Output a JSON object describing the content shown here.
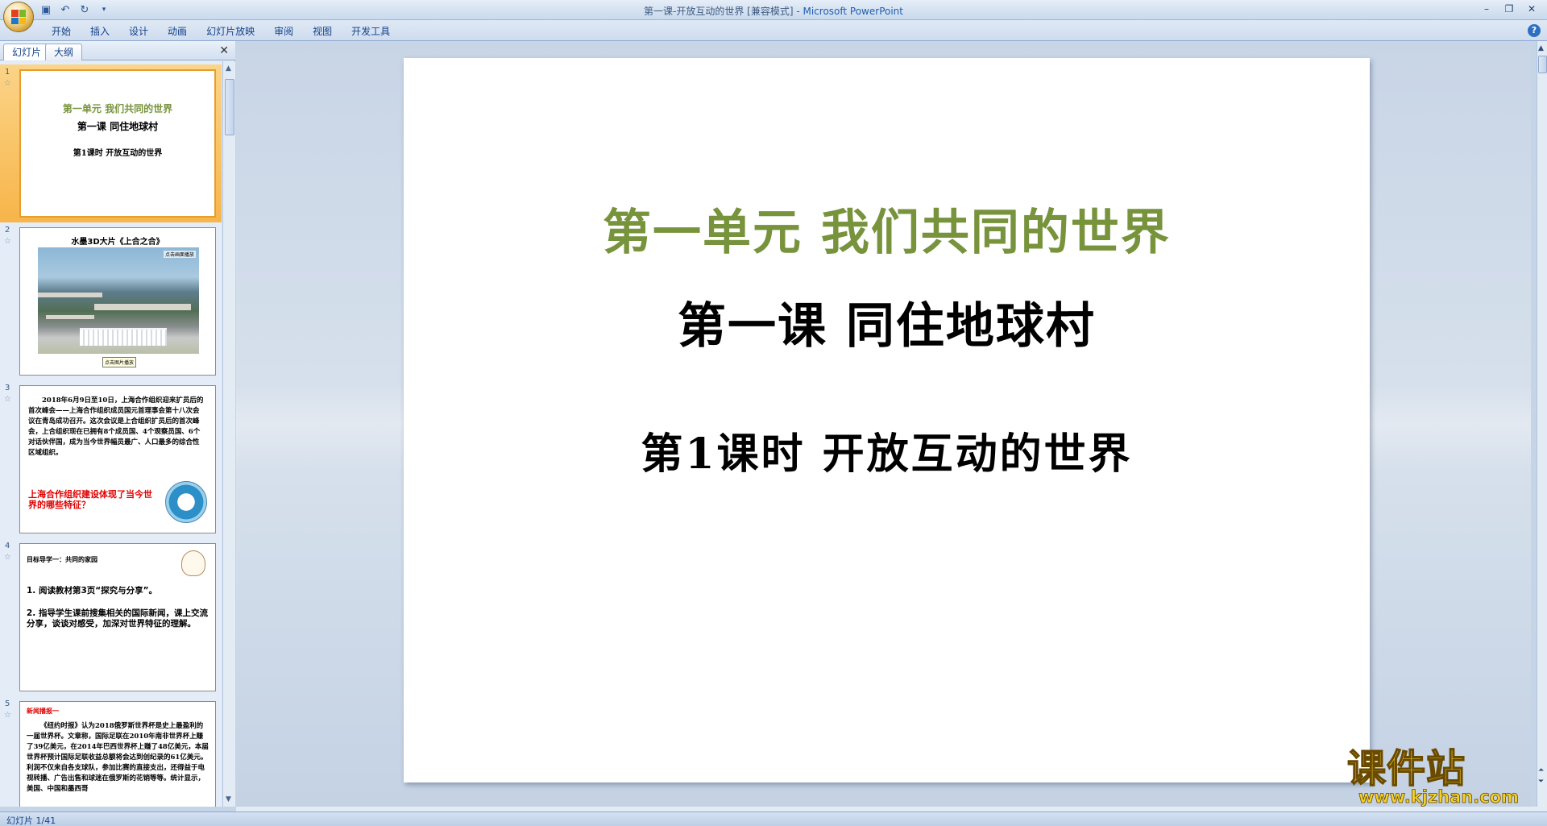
{
  "window": {
    "title": "第一课-开放互动的世界 [兼容模式]",
    "separator": " - ",
    "app_name": "Microsoft PowerPoint",
    "controls": [
      "–",
      "❐",
      "✕"
    ]
  },
  "quick_access": {
    "icons": [
      "save-icon",
      "undo-icon",
      "redo-icon",
      "customize-icon"
    ]
  },
  "ribbon": {
    "tabs": [
      "开始",
      "插入",
      "设计",
      "动画",
      "幻灯片放映",
      "审阅",
      "视图",
      "开发工具"
    ]
  },
  "left_panel": {
    "tabs": [
      "幻灯片",
      "大纲"
    ],
    "close_glyph": "✕"
  },
  "thumbnails": [
    {
      "num": "1",
      "line1": "第一单元  我们共同的世界",
      "line2": "第一课  同住地球村",
      "line3": "第1课时  开放互动的世界"
    },
    {
      "num": "2",
      "title": "水墨3D大片《上合之合》",
      "label1": "点击画面播放",
      "label2": "点击图片播放"
    },
    {
      "num": "3",
      "text": "2018年6月9日至10日，上海合作组织迎来扩员后的首次峰会——上海合作组织成员国元首理事会第十八次会议在青岛成功召开。这次会议是上合组织扩员后的首次峰会，上合组织现在已拥有8个成员国、4个观察员国、6个对话伙伴国，成为当今世界幅员最广、人口最多的综合性区域组织。",
      "question": "上海合作组织建设体现了当今世界的哪些特征？"
    },
    {
      "num": "4",
      "heading": "目标导学一：共同的家园",
      "item1": "1. 阅读教材第3页“探究与分享”。",
      "item2": "2. 指导学生课前搜集相关的国际新闻，课上交流分享，谈谈对感受，加深对世界特征的理解。"
    },
    {
      "num": "5",
      "heading": "新闻播报一",
      "text": "《纽约时报》认为2018俄罗斯世界杯是史上最盈利的一届世界杯。文章称，国际足联在2010年南非世界杯上赚了39亿美元，在2014年巴西世界杯上赚了48亿美元，本届世界杯预计国际足联收益总额将会达到创纪录的61亿美元。利润不仅来自各支球队，参加比赛的直接支出，还得益于电视转播、广告出售和球迷在俄罗斯的花销等等。统计显示，美国、中国和墨西哥"
    }
  ],
  "slide": {
    "title1": "第一单元  我们共同的世界",
    "title2": "第一课  同住地球村",
    "title3": "第1课时  开放互动的世界",
    "colors": {
      "title1": "#77933c",
      "title2": "#000000",
      "title3": "#000000"
    }
  },
  "status": {
    "slide_indicator": "幻灯片 1/41"
  },
  "watermark": {
    "logo": "课件站",
    "url": "www.kjzhan.com"
  }
}
